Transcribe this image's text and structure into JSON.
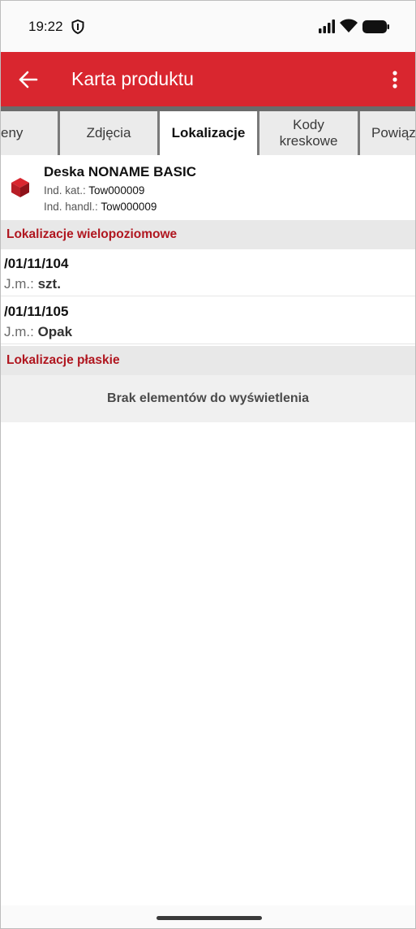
{
  "status_bar": {
    "time": "19:22",
    "icons": [
      "shield-icon",
      "signal-icon",
      "wifi-icon",
      "battery-icon"
    ]
  },
  "app_bar": {
    "title": "Karta produktu",
    "back_icon": "arrow-left-icon",
    "menu_icon": "more-vert-icon",
    "color": "#d9262f"
  },
  "tabs": [
    {
      "label": "eny",
      "active": false
    },
    {
      "label": "Zdjęcia",
      "active": false
    },
    {
      "label": "Lokalizacje",
      "active": true
    },
    {
      "label": "Kody kreskowe",
      "active": false
    },
    {
      "label": "Powiąz",
      "active": false
    }
  ],
  "product": {
    "icon": "box-icon",
    "name": "Deska NONAME BASIC",
    "catalog_label": "Ind. kat.:",
    "catalog_value": "Tow000009",
    "trade_label": "Ind. handl.:",
    "trade_value": "Tow000009"
  },
  "sections": {
    "multi_level": {
      "title": "Lokalizacje wielopoziomowe",
      "items": [
        {
          "code": "/01/11/104",
          "unit_label": "J.m.:",
          "unit_value": "szt."
        },
        {
          "code": "/01/11/105",
          "unit_label": "J.m.:",
          "unit_value": "Opak"
        }
      ]
    },
    "flat": {
      "title": "Lokalizacje płaskie",
      "empty_message": "Brak elementów do wyświetlenia"
    }
  },
  "accent_color": "#b0161f"
}
